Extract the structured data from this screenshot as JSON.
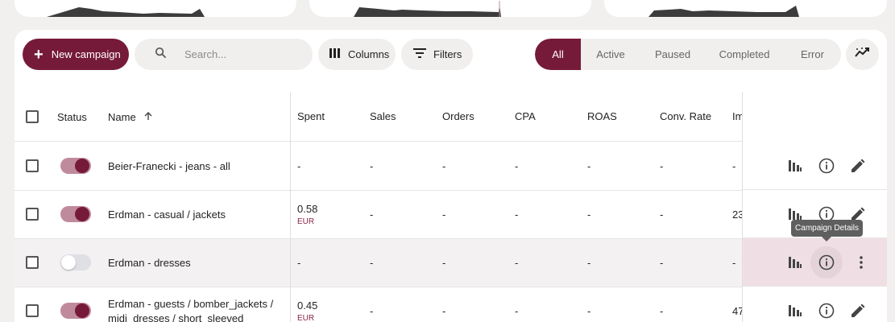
{
  "toolbar": {
    "new_campaign_label": "New campaign",
    "search_placeholder": "Search...",
    "columns_label": "Columns",
    "filters_label": "Filters"
  },
  "status_filter": {
    "options": [
      "All",
      "Active",
      "Paused",
      "Completed",
      "Error"
    ],
    "selected": "All"
  },
  "table": {
    "columns": [
      "Status",
      "Name",
      "Spent",
      "Sales",
      "Orders",
      "CPA",
      "ROAS",
      "Conv. Rate",
      "Im"
    ],
    "sort": {
      "column": "Name",
      "direction": "ascending",
      "icon": "arrow-up-icon"
    },
    "rows": [
      {
        "active": true,
        "name": "Beier-Franecki - jeans - all",
        "spent": "-",
        "spent_currency": "",
        "sales": "-",
        "orders": "-",
        "cpa": "-",
        "roas": "-",
        "conv_rate": "-",
        "impressions": "-"
      },
      {
        "active": true,
        "name": "Erdman - casual / jackets",
        "spent": "0.58",
        "spent_currency": "EUR",
        "sales": "-",
        "orders": "-",
        "cpa": "-",
        "roas": "-",
        "conv_rate": "-",
        "impressions": "23"
      },
      {
        "active": false,
        "name": "Erdman - dresses",
        "spent": "-",
        "spent_currency": "",
        "sales": "-",
        "orders": "-",
        "cpa": "-",
        "roas": "-",
        "conv_rate": "-",
        "impressions": "-"
      },
      {
        "active": true,
        "name": "Erdman - guests / bomber_jackets / midi_dresses / short_sleeved",
        "spent": "0.45",
        "spent_currency": "EUR",
        "sales": "-",
        "orders": "-",
        "cpa": "-",
        "roas": "-",
        "conv_rate": "-",
        "impressions": "47"
      }
    ]
  },
  "row_actions": {
    "icons": [
      "bar-chart-icon",
      "info-icon",
      "edit-icon"
    ],
    "hover_row_icons": [
      "bar-chart-icon",
      "info-icon",
      "more-vert-icon"
    ]
  },
  "tooltip": {
    "text": "Campaign Details"
  },
  "colors": {
    "accent": "#761a3a",
    "toggle_track_on": "#c08a9d",
    "currency_text": "#8a2545"
  }
}
